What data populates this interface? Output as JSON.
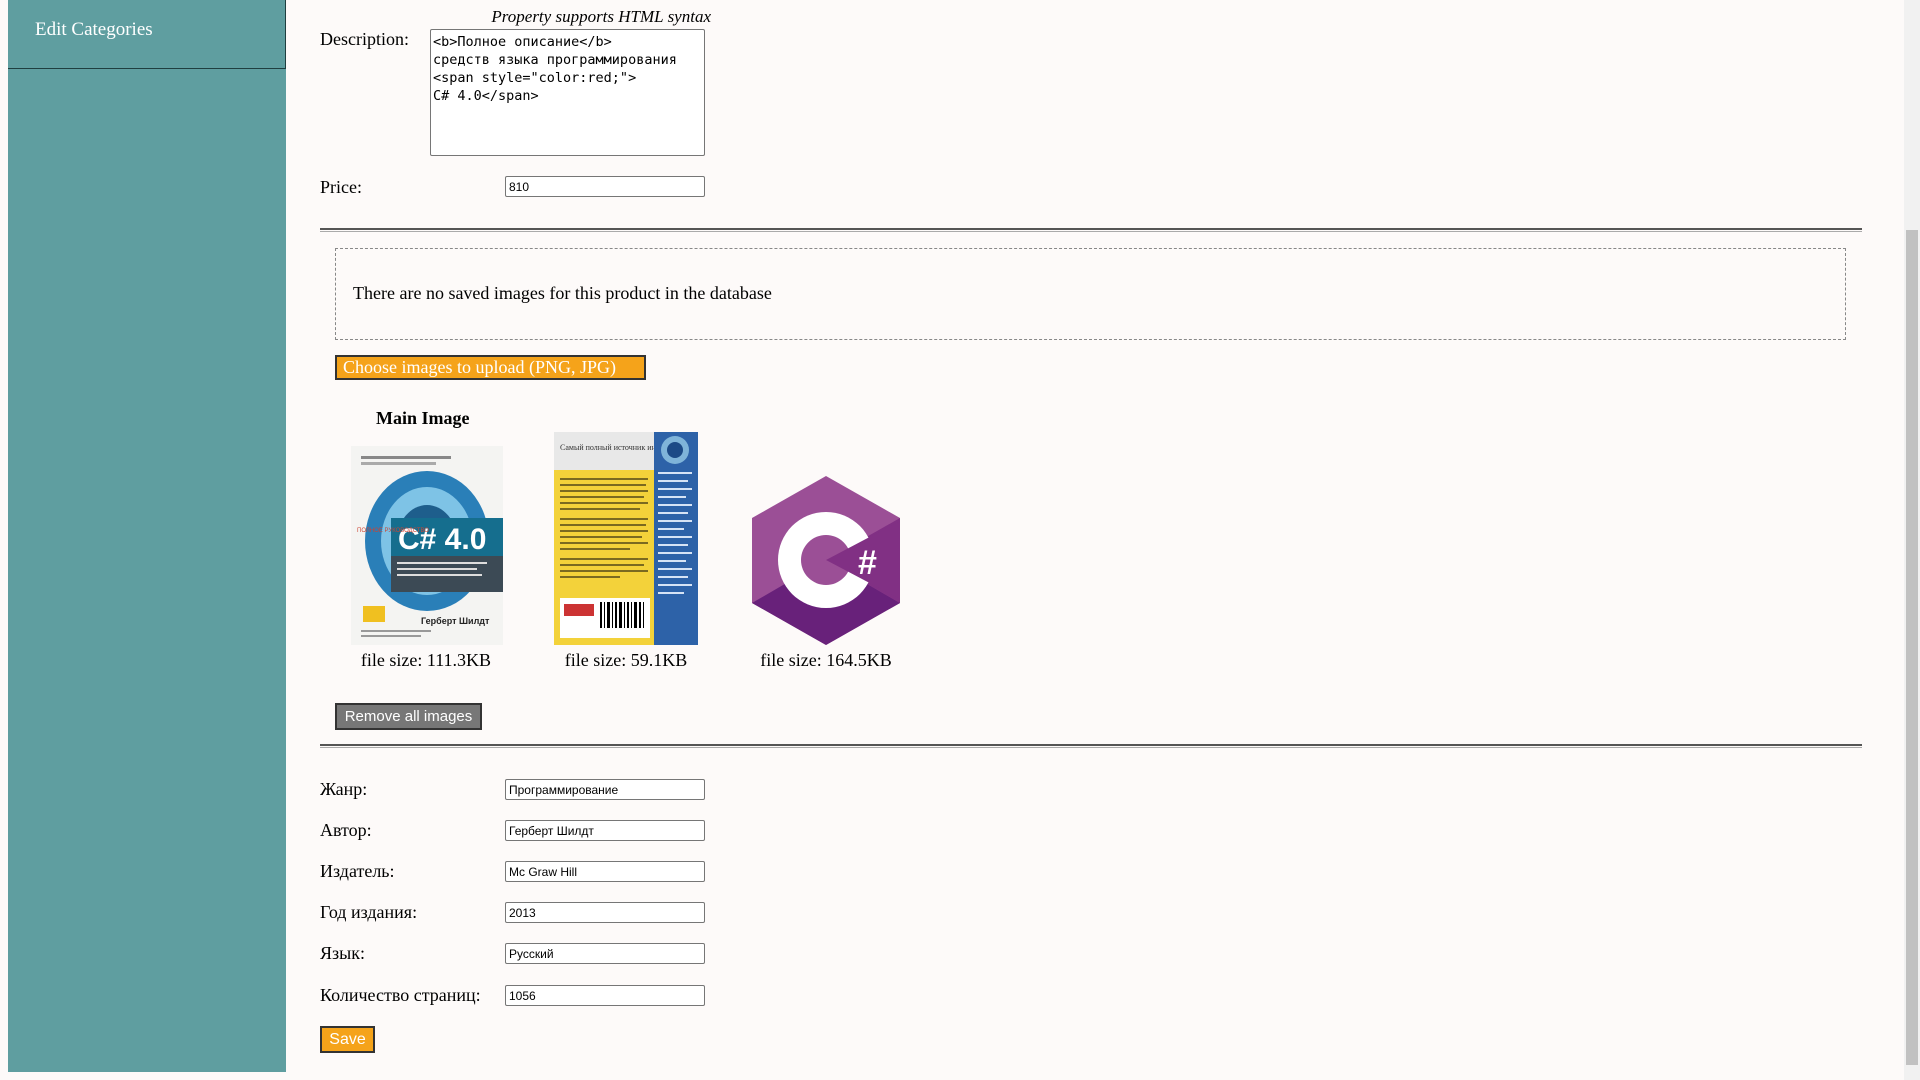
{
  "sidebar": {
    "items": [
      {
        "label": "Edit Categories"
      }
    ]
  },
  "form": {
    "html_hint": "Property supports HTML syntax",
    "description_label": "Description:",
    "description_value": "<b>Полное описание</b>\nсредств языка программирования\n<span style=\"color:red;\">\nC# 4.0</span>",
    "price_label": "Price:",
    "price_value": "810"
  },
  "images": {
    "no_images_text": "There are no saved images for this product in the database",
    "upload_button": "Choose images to upload (PNG, JPG)",
    "main_image_title": "Main Image",
    "items": [
      {
        "name": "front-cover",
        "file_size": "file size: 111.3KB",
        "cover_title": "C# 4.0",
        "cover_subtitle": "ПОЛНОЕ РУКОВОДСТВО",
        "author": "Герберт Шилдт"
      },
      {
        "name": "back-cover",
        "file_size": "file size: 59.1KB",
        "cover_heading": "Самый полный источник информации по C#"
      },
      {
        "name": "csharp-logo",
        "file_size": "file size: 164.5KB",
        "logo_text": "C#"
      }
    ],
    "remove_button": "Remove all images"
  },
  "properties": [
    {
      "label": "Жанр:",
      "value": "Программирование"
    },
    {
      "label": "Автор:",
      "value": "Герберт Шилдт"
    },
    {
      "label": "Издатель:",
      "value": "Mc Graw Hill"
    },
    {
      "label": "Год издания:",
      "value": "2013"
    },
    {
      "label": "Язык:",
      "value": "Русский"
    },
    {
      "label": "Количество страниц:",
      "value": "1056"
    }
  ],
  "save_button": "Save",
  "colors": {
    "sidebar": "#5f9ea0",
    "accent": "#f5a31a",
    "csharp_purple": "#9b4f96"
  }
}
